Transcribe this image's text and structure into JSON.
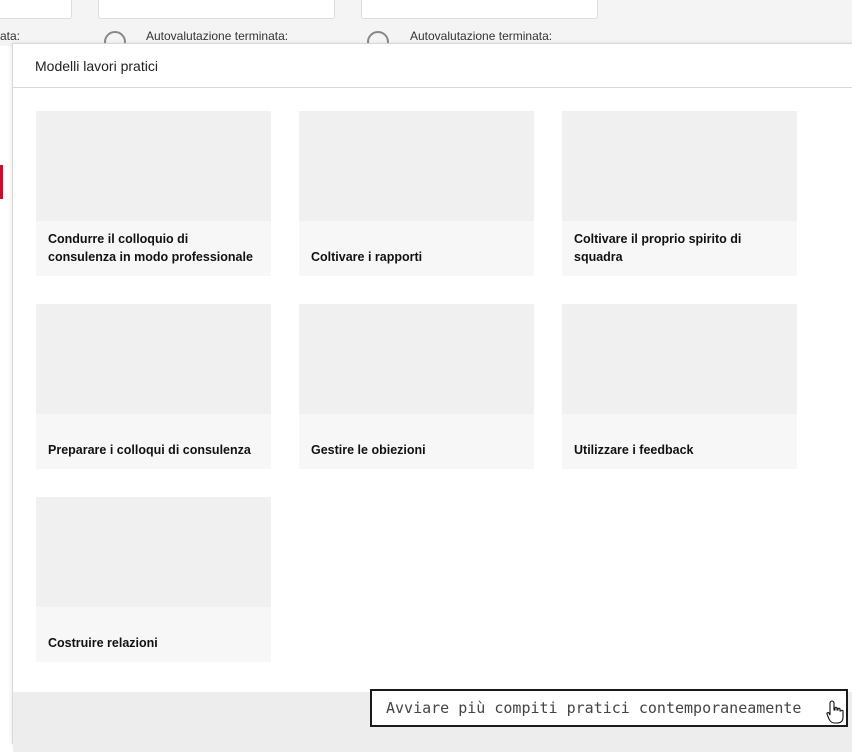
{
  "background": {
    "left_label": "ata:",
    "status_1": "Autovalutazione terminata:",
    "status_2": "Autovalutazione terminata:"
  },
  "popover": {
    "title": "Modelli lavori pratici",
    "cards": [
      {
        "title": "Condurre il colloquio di consulenza in modo professionale"
      },
      {
        "title": "Coltivare i rapporti"
      },
      {
        "title": "Coltivare il proprio spirito di squadra"
      },
      {
        "title": "Preparare i colloqui di consulenza"
      },
      {
        "title": "Gestire le obiezioni"
      },
      {
        "title": "Utilizzare i feedback"
      },
      {
        "title": "Costruire relazioni"
      }
    ]
  },
  "tooltip": {
    "text": "Avviare più compiti pratici contemporaneamente"
  },
  "colors": {
    "accent_red": "#c8102e",
    "card_bg": "#f0f0f0",
    "footer_bg": "#ededed"
  }
}
